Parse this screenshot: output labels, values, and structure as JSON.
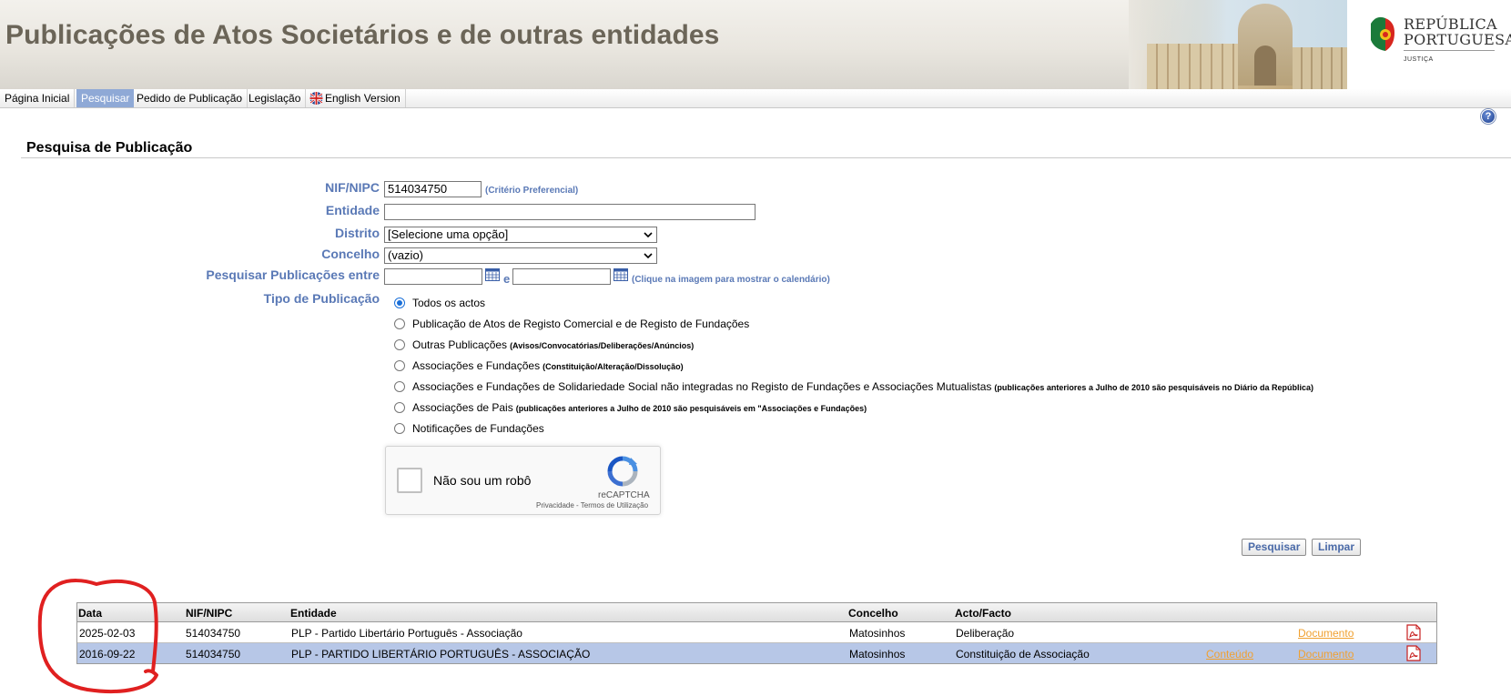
{
  "header": {
    "title": "Publicações de Atos Societários e de outras entidades",
    "logo_line1": "REPÚBLICA",
    "logo_line2": "PORTUGUESA",
    "logo_sub": "JUSTIÇA"
  },
  "nav": {
    "items": [
      {
        "label": "Página Inicial",
        "active": false
      },
      {
        "label": "Pesquisar",
        "active": true
      },
      {
        "label": "Pedido de Publicação",
        "active": false
      },
      {
        "label": "Legislação",
        "active": false
      },
      {
        "label": "English Version",
        "active": false,
        "icon": "uk-flag-icon"
      }
    ]
  },
  "help_icon": "?",
  "section": {
    "title": "Pesquisa de Publicação"
  },
  "form": {
    "nif_label": "NIF/NIPC",
    "nif_value": "514034750",
    "nif_hint": "(Critério Preferencial)",
    "entidade_label": "Entidade",
    "entidade_value": "",
    "distrito_label": "Distrito",
    "distrito_value": "[Selecione uma opção]",
    "concelho_label": "Concelho",
    "concelho_value": "(vazio)",
    "datas_label": "Pesquisar Publicações entre",
    "datas_between": "e",
    "datas_hint": "(Clique na imagem para mostrar o calendário)",
    "tipo_label": "Tipo de Publicação",
    "tipo_options": [
      {
        "label": "Todos os actos",
        "note": "",
        "checked": true
      },
      {
        "label": "Publicação de Atos de Registo Comercial e de Registo de Fundações",
        "note": "",
        "checked": false
      },
      {
        "label": "Outras Publicações",
        "note": "(Avisos/Convocatórias/Deliberações/Anúncios)",
        "checked": false
      },
      {
        "label": "Associações e Fundações",
        "note": "(Constituição/Alteração/Dissolução)",
        "checked": false
      },
      {
        "label": "Associações e Fundações de Solidariedade Social não integradas no Registo de Fundações e Associações Mutualistas",
        "note": "(publicações anteriores a Julho de 2010 são pesquisáveis no Diário da República)",
        "checked": false
      },
      {
        "label": "Associações de Pais",
        "note": "(publicações anteriores a Julho de 2010 são pesquisáveis em \"Associações e Fundações)",
        "checked": false
      },
      {
        "label": "Notificações de Fundações",
        "note": "",
        "checked": false
      }
    ]
  },
  "captcha": {
    "label": "Não sou um robô",
    "brand": "reCAPTCHA",
    "links": "Privacidade - Termos de Utilização"
  },
  "buttons": {
    "search": "Pesquisar",
    "clear": "Limpar"
  },
  "results": {
    "headers": [
      "Data",
      "NIF/NIPC",
      "Entidade",
      "Concelho",
      "Acto/Facto"
    ],
    "rows": [
      {
        "data": "2025-02-03",
        "nif": "514034750",
        "entidade": "PLP - Partido Libertário Português - Associação",
        "concelho": "Matosinhos",
        "acto": "Deliberação",
        "conteudo": "",
        "documento": "Documento"
      },
      {
        "data": "2016-09-22",
        "nif": "514034750",
        "entidade": "PLP - PARTIDO LIBERTÁRIO PORTUGUÊS - ASSOCIAÇÃO",
        "concelho": "Matosinhos",
        "acto": "Constituição de Associação",
        "conteudo": "Conteúdo",
        "documento": "Documento"
      }
    ]
  },
  "colors": {
    "label_blue": "#5a79b6",
    "nav_active": "#8fa9d6",
    "row_highlight": "#b7c7e7",
    "link_orange": "#f0a030",
    "annotation_red": "#e02020"
  }
}
